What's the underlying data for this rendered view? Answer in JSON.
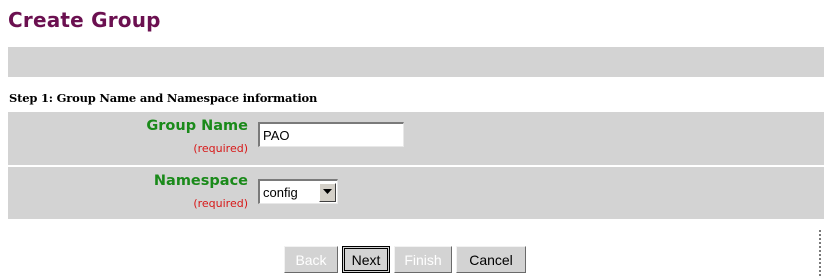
{
  "page": {
    "title": "Create Group"
  },
  "step": {
    "title": "Step 1: Group Name and Namespace information"
  },
  "form": {
    "group_name": {
      "label": "Group Name",
      "required_note": "(required)",
      "value": "PAO"
    },
    "namespace": {
      "label": "Namespace",
      "required_note": "(required)",
      "selected": "config"
    }
  },
  "buttons": {
    "back": "Back",
    "next": "Next",
    "finish": "Finish",
    "cancel": "Cancel"
  },
  "colors": {
    "title": "#6b1050",
    "label": "#1a8a1a",
    "required": "#d81818",
    "panel": "#d3d3d3"
  }
}
